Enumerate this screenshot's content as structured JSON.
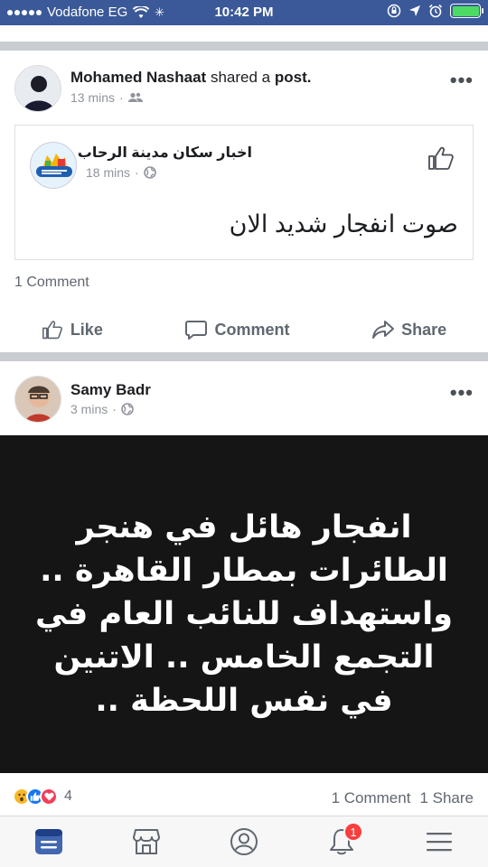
{
  "status_bar": {
    "carrier": "Vodafone EG",
    "time": "10:42 PM"
  },
  "colors": {
    "fb_blue": "#3b5998",
    "action_gray": "#606770",
    "meta_gray": "#90949c",
    "image_bg": "#151515",
    "badge_red": "#fa3e3e"
  },
  "post1": {
    "author": "Mohamed Nashaat",
    "action_text": "shared a",
    "object_text": "post.",
    "time": "13 mins",
    "privacy_icon": "friends-icon",
    "shared": {
      "page_name": "اخبار سكان مدينة الرحاب",
      "time": "18 mins",
      "privacy_icon": "globe-icon",
      "text": "صوت انفجار شديد الان"
    },
    "comment_count": "1 Comment",
    "actions": {
      "like": "Like",
      "comment": "Comment",
      "share": "Share"
    }
  },
  "post2": {
    "author": "Samy Badr",
    "time": "3 mins",
    "privacy_icon": "globe-icon",
    "image_text": "انفجار هائل في هنجر الطائرات بمطار القاهرة .. واستهداف للنائب العام في التجمع الخامس .. الاتنين في نفس اللحظة ..",
    "reactions": [
      "wow",
      "like",
      "love"
    ],
    "reaction_count": "4",
    "comments": "1 Comment",
    "shares": "1 Share"
  },
  "tabbar": {
    "tabs": [
      "news-feed-icon",
      "marketplace-icon",
      "profile-icon",
      "notifications-icon",
      "menu-icon"
    ],
    "notification_badge": "1"
  }
}
